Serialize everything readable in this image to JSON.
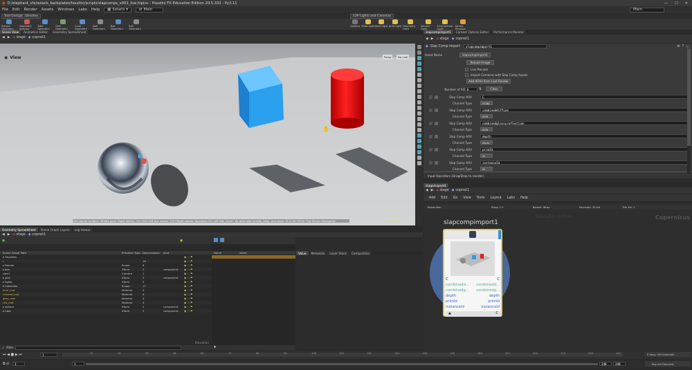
{
  "title_bar": {
    "text": "D:/elephant_vfx/solaris_backplates/houdini/scripts/slapcomps_v001_live.hiplnc - Houdini FX Education Edition 20.5.332 - Py3.11",
    "controls": [
      "—",
      "☐",
      "✕"
    ]
  },
  "menu": {
    "items": [
      "File",
      "Edit",
      "Render",
      "Assets",
      "Windows",
      "Labs",
      "Help"
    ],
    "desktop": "Solaris",
    "context": "Main",
    "right_combo": "Main"
  },
  "shelf": {
    "tabs": [
      "Tool Gen(geo)",
      "Utinotes"
    ],
    "lights_tab": "LOP Lights and Cameras",
    "tools_left": [
      "Sphere\nGeometry",
      "Geometry\nSelector",
      "Tube\nGeometry",
      "Grid\nGeometry",
      "Cone\nGeometry",
      "Null\nGeometry",
      "Box\nGeometry",
      "Edit\nGeometry"
    ],
    "tools_right": [
      "Camera",
      "Point Light",
      "Spot Light",
      "Area Light",
      "Geometry\nLight",
      "Volume Light",
      "Environment\nLight",
      "Karma\nPhysical Sk..."
    ]
  },
  "left_tabs": {
    "tabs": [
      "Scene View",
      "Animation Editor",
      "Geometry Spreadsheet"
    ],
    "active": 0
  },
  "left_path": {
    "context": "stage",
    "node": "copnet1"
  },
  "viewport": {
    "label": "View",
    "camera_menu": "Persp",
    "cam_label": "No cam",
    "status": "Left mouse tumbles. Middle pans. Right dollies. Ctrl+Alt+Left box zooms. Ctrl+Right zooms. Spacebar-Ctrl-Left tilts. Hold L for alternate tumble, dolly, and zoom. M or Alt+M for First Person Navigation.",
    "renderer": "Karma XPU"
  },
  "right_tabs": {
    "tabs": [
      "slapcompimport1",
      "Context Options Editor",
      "Performance Monitor"
    ],
    "active": 0
  },
  "param_path": {
    "context": "stage",
    "node": "copnet1"
  },
  "params": {
    "node_type": "Slap Comp Import",
    "node_name": "slapcompimport1",
    "asset_name_label": "Asset Name",
    "asset_name_value": "slapcompimport1",
    "reload_label": "Reload Image",
    "live_recook": "Live Recook",
    "import_cameras": "Import Cameras with Slap Comp Inputs",
    "add_aovs": "Add AOVs from Last Render",
    "num_aovs_label": "Number of AOVs",
    "num_aovs_value": "6",
    "clear_label": "Clear",
    "aov_label": "Slap Comp AOV",
    "channel_type_label": "Channel Type",
    "aovs": [
      {
        "name": "C",
        "type": "RGBA"
      },
      {
        "name": "combineddiffuse",
        "type": "RGB"
      },
      {
        "name": "combinedglossyreflection",
        "type": "RGB"
      },
      {
        "name": "depth",
        "type": "Mono"
      },
      {
        "name": "primId",
        "type": "ID"
      },
      {
        "name": "instanceId",
        "type": "ID"
      }
    ],
    "input_ops": "Input Operators (Drag/Drop to reorder)"
  },
  "net_tabs": {
    "tabs": [
      "stage/copnet1"
    ],
    "active": 0
  },
  "net_path": {
    "context": "stage",
    "node": "copnet1"
  },
  "net_menu": [
    "Add",
    "Edit",
    "Go",
    "View",
    "Tools",
    "Layout",
    "Labs",
    "Help"
  ],
  "net_info": {
    "resolution_label": "Resolution",
    "proxy": "Proxy 1:2",
    "border": "Border: Wrap",
    "precision": "Precision: 32-bit",
    "tile": "Tile Vis: 1"
  },
  "network": {
    "watermark_edu": "Education Edition",
    "watermark_ctx": "Copernicus",
    "node_title": "slapcompimport1",
    "outputs_left": [
      "C",
      "combinedd...",
      "combinedg...",
      "depth",
      "primId",
      "instanceId"
    ],
    "outputs_right": [
      "C",
      "combinedd...",
      "combinedg...",
      "depth",
      "primId",
      "instanceId"
    ],
    "bottom_left": "▲",
    "bottom_right": "C"
  },
  "lower_tabs": {
    "tabs": [
      "Geometry Spreadsheet",
      "Scene Graph Layers",
      "Log Viewer"
    ],
    "active": 0
  },
  "lower_path": {
    "context": "stage",
    "node": "copnet1"
  },
  "scene_graph": {
    "columns": [
      "Scene Graph Path",
      "Primitive Type",
      "Descendants",
      "Kind"
    ],
    "rows": [
      {
        "path": "▸ Favorites",
        "type": "",
        "desc": "",
        "kind": ""
      },
      {
        "path": "/",
        "type": "",
        "desc": "16",
        "kind": ""
      },
      {
        "path": "  ▸ Render",
        "type": "Scope",
        "desc": "8",
        "kind": ""
      },
      {
        "path": "  ▸ box",
        "type": "Xform",
        "desc": "2",
        "kind": "component"
      },
      {
        "path": "    cam1",
        "type": "Camera",
        "desc": "1",
        "kind": ""
      },
      {
        "path": "  ▸ grid",
        "type": "Xform",
        "desc": "2",
        "kind": "component"
      },
      {
        "path": "  ▸ lights",
        "type": "Xform",
        "desc": "2",
        "kind": ""
      },
      {
        "path": "  ▾ materials",
        "type": "Scope",
        "desc": "17",
        "kind": ""
      },
      {
        "path": "      blue_mat",
        "type": "Material",
        "desc": "4",
        "kind": ""
      },
      {
        "path": "      chrome_mat",
        "type": "Material",
        "desc": "4",
        "kind": ""
      },
      {
        "path": "      grey_mat",
        "type": "Material",
        "desc": "4",
        "kind": ""
      },
      {
        "path": "      red_mat",
        "type": "Material",
        "desc": "4",
        "kind": ""
      },
      {
        "path": "  ▸ sphere",
        "type": "Xform",
        "desc": "2",
        "kind": "component"
      },
      {
        "path": "  ▸ tube",
        "type": "Xform",
        "desc": "2",
        "kind": "component"
      }
    ],
    "filter_label": "Filter",
    "edu": "Education"
  },
  "props": {
    "columns": [
      "Name",
      "Value"
    ],
    "tabs": [
      "Value",
      "Metadata",
      "Layer Stack",
      "Composition"
    ]
  },
  "timeline": {
    "frame": "1",
    "start": "1",
    "end": "240",
    "end2": "240",
    "ticks": [
      "12",
      "24",
      "36",
      "48",
      "60",
      "72",
      "84",
      "96",
      "108",
      "120",
      "132",
      "144",
      "156",
      "168",
      "180",
      "192",
      "204",
      "216",
      "228",
      "240"
    ],
    "keys_info": "0 keys, 0/0 channels",
    "key_all": "Key All Channels"
  }
}
